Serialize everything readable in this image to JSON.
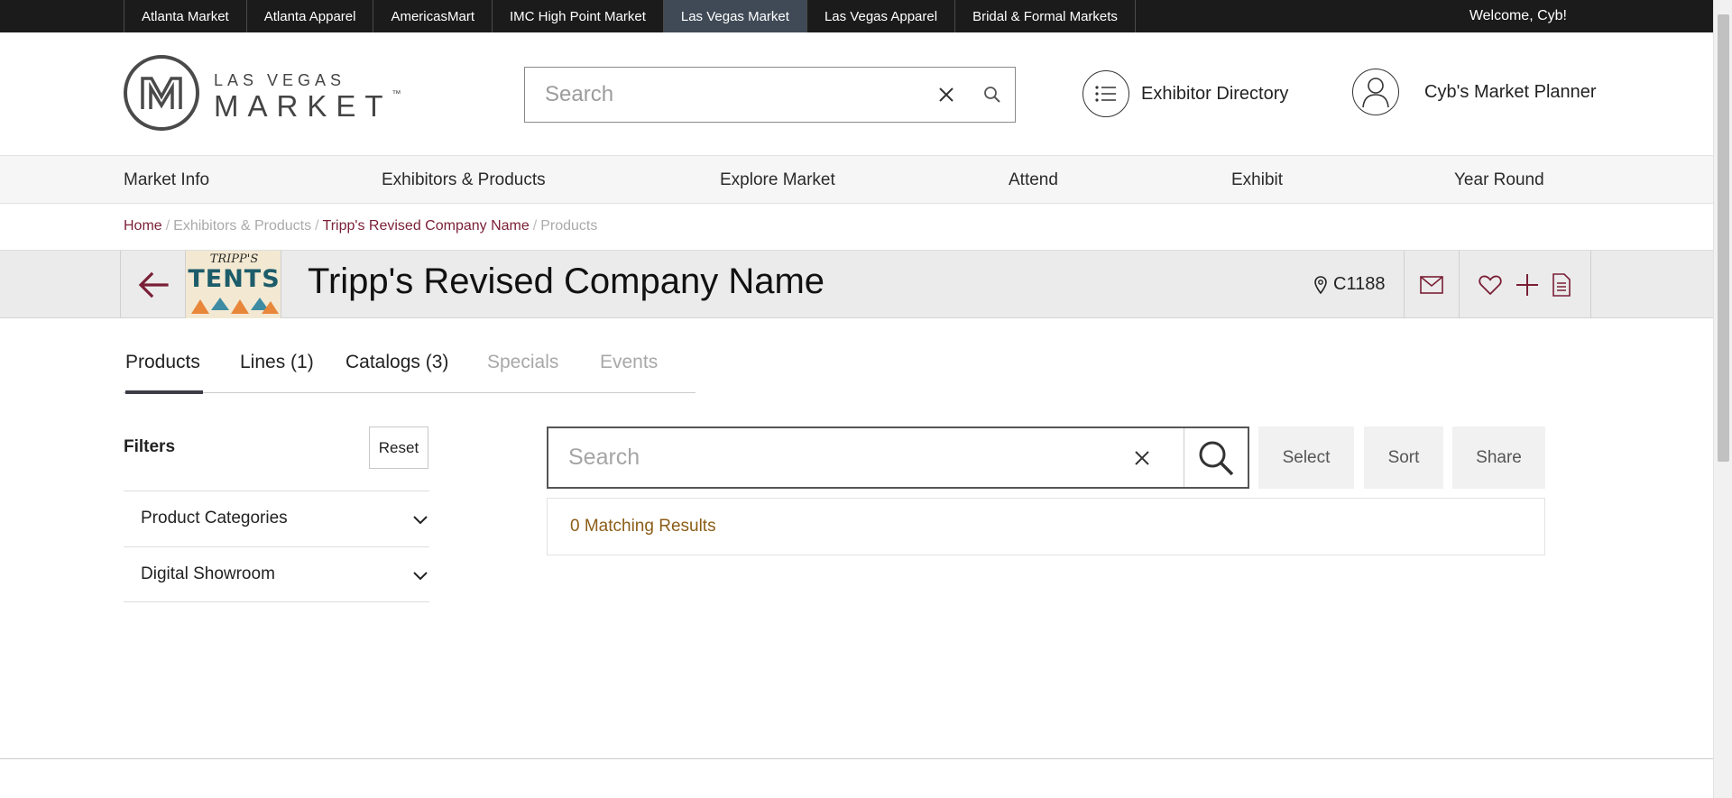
{
  "topbar": {
    "markets": [
      {
        "label": "Atlanta Market",
        "active": false
      },
      {
        "label": "Atlanta Apparel",
        "active": false
      },
      {
        "label": "AmericasMart",
        "active": false
      },
      {
        "label": "IMC High Point Market",
        "active": false
      },
      {
        "label": "Las Vegas Market",
        "active": true
      },
      {
        "label": "Las Vegas Apparel",
        "active": false
      },
      {
        "label": "Bridal & Formal Markets",
        "active": false
      }
    ],
    "welcome": "Welcome, Cyb!"
  },
  "header": {
    "logo_top": "LAS VEGAS",
    "logo_main": "MARKET",
    "logo_tm": "™",
    "search": {
      "placeholder": "Search",
      "value": ""
    },
    "exhibitor_directory": "Exhibitor Directory",
    "market_planner": "Cyb's Market Planner"
  },
  "main_nav": [
    "Market Info",
    "Exhibitors & Products",
    "Explore Market",
    "Attend",
    "Exhibit",
    "Year Round"
  ],
  "breadcrumb": {
    "home": "Home",
    "section": "Exhibitors & Products",
    "company": "Tripp's Revised Company Name",
    "current": "Products",
    "separator": "/"
  },
  "exhibitor": {
    "logo_line1": "TRIPP'S",
    "logo_line2": "TENTS",
    "name": "Tripp's Revised Company Name",
    "booth": "C1188"
  },
  "tabs": [
    {
      "label": "Products",
      "state": "active"
    },
    {
      "label": "Lines (1)",
      "state": "enabled"
    },
    {
      "label": "Catalogs (3)",
      "state": "enabled"
    },
    {
      "label": "Specials",
      "state": "disabled"
    },
    {
      "label": "Events",
      "state": "disabled"
    }
  ],
  "filters": {
    "title": "Filters",
    "reset": "Reset",
    "facets": [
      "Product Categories",
      "Digital Showroom"
    ]
  },
  "product_search": {
    "placeholder": "Search",
    "value": ""
  },
  "buttons": {
    "select": "Select",
    "sort": "Sort",
    "share": "Share"
  },
  "results": {
    "text": "0 Matching Results"
  },
  "colors": {
    "accent": "#7a1f36",
    "topbar_bg": "#1b1b1b",
    "active_market_bg": "#3f4a56",
    "results_text": "#8c5d18",
    "tab_underline": "#3d3d47"
  },
  "icons": [
    "lvm-logo-icon",
    "close-icon",
    "search-icon",
    "list-icon",
    "user-icon",
    "arrow-left-icon",
    "map-pin-icon",
    "mail-icon",
    "heart-icon",
    "plus-icon",
    "document-icon",
    "chevron-down-icon"
  ]
}
